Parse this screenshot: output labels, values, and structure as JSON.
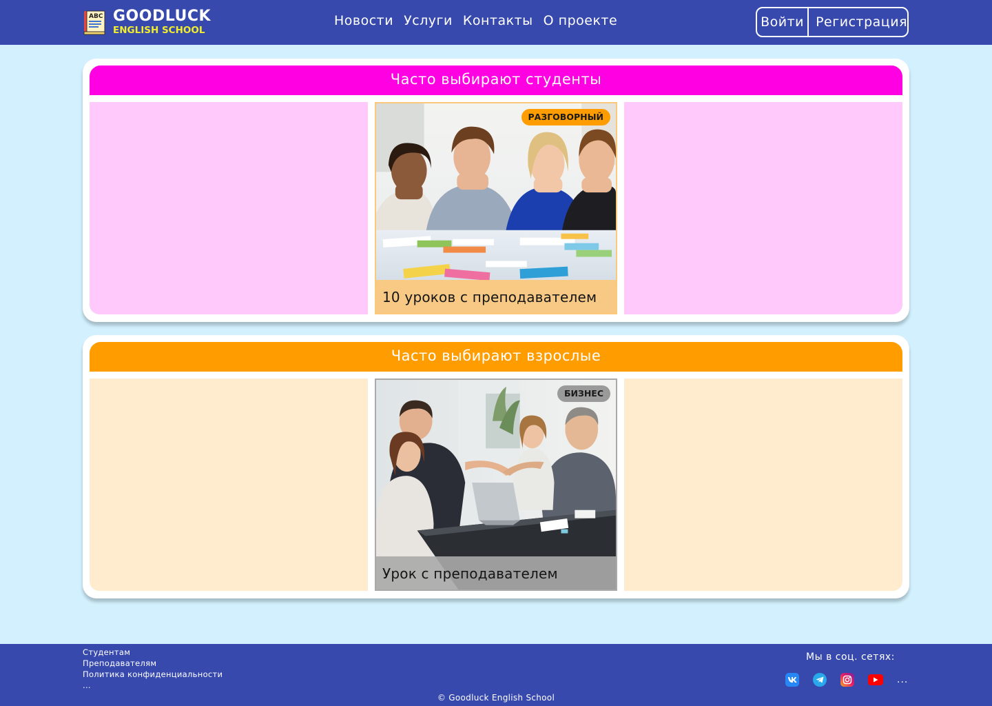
{
  "header": {
    "logo": {
      "title": "GOODLUCK",
      "subtitle": "ENGLISH SCHOOL",
      "icon": "abc-book-icon",
      "icon_text": "ABC"
    },
    "nav": [
      "Новости",
      "Услуги",
      "Контакты",
      "О проекте"
    ],
    "auth": {
      "login": "Войти",
      "register": "Регистрация"
    }
  },
  "sections": [
    {
      "title": "Часто выбирают студенты",
      "card": {
        "badge": "РАЗГОВОРНЫЙ",
        "caption": "10 уроков с преподавателем",
        "image": "students-photo"
      }
    },
    {
      "title": "Часто выбирают взрослые",
      "card": {
        "badge": "БИЗНЕС",
        "caption": "Урок с преподавателем",
        "image": "business-meeting-photo"
      }
    }
  ],
  "footer": {
    "links": [
      "Студентам",
      "Преподавателям",
      "Политика конфиденциальности",
      "..."
    ],
    "social_title": "Мы в соц. сетях:",
    "social": [
      "vk-icon",
      "telegram-icon",
      "instagram-icon",
      "youtube-icon"
    ],
    "social_more": "...",
    "copyright": "© Goodluck English School"
  },
  "colors": {
    "header_bg": "#3749ad",
    "page_bg": "#d2f0fd",
    "students_accent": "#ff00e3",
    "adults_accent": "#ff9c00",
    "logo_subtitle": "#f2ee2a"
  }
}
